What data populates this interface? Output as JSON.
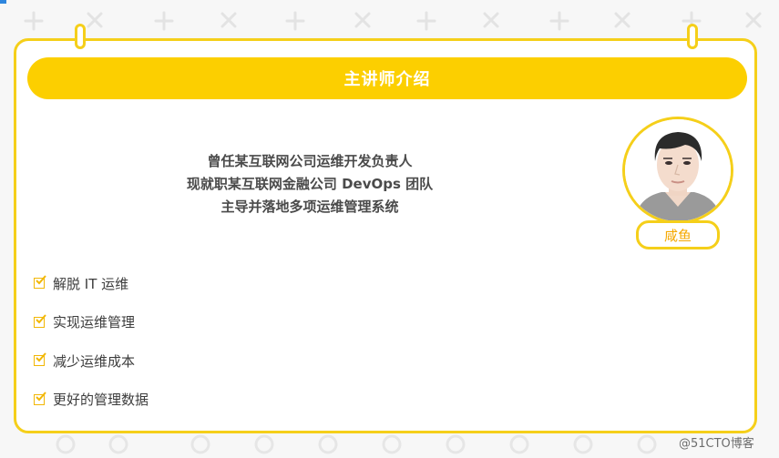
{
  "header": {
    "title": "主讲师介绍"
  },
  "intro": {
    "lines": [
      "曾任某互联网公司运维开发负责人",
      "现就职某互联网金融公司 DevOps 团队",
      "主导并落地多项运维管理系统"
    ]
  },
  "instructor": {
    "name": "咸鱼"
  },
  "checklist": {
    "items": [
      {
        "label": "解脱 IT 运维"
      },
      {
        "label": "实现运维管理"
      },
      {
        "label": "减少运维成本"
      },
      {
        "label": "更好的管理数据"
      }
    ]
  },
  "watermark": "@51CTO博客",
  "colors": {
    "accent": "#fccf00",
    "border": "#f5cf1a",
    "name_text": "#f5a800"
  }
}
